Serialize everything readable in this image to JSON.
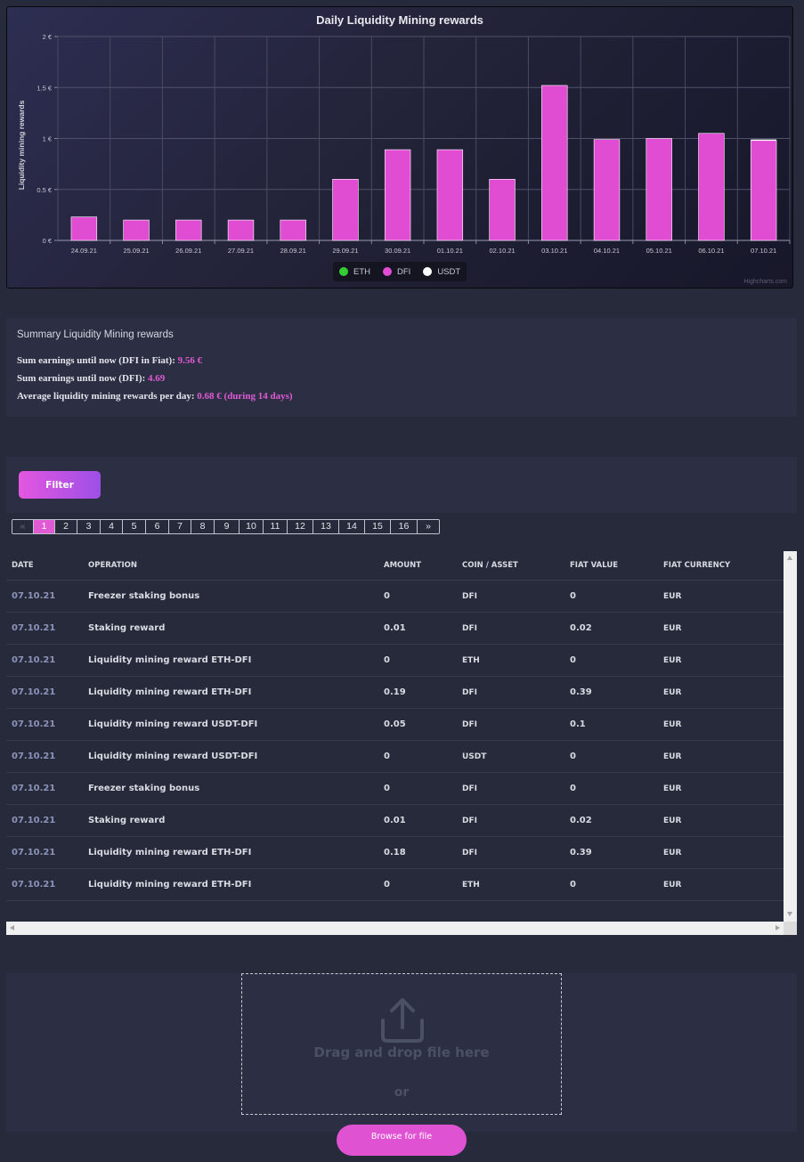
{
  "chart_data": {
    "type": "bar",
    "title": "Daily Liquidity Mining rewards",
    "ylabel": "Liquidity mining rewards",
    "categories": [
      "24.09.21",
      "25.09.21",
      "26.09.21",
      "27.09.21",
      "28.09.21",
      "29.09.21",
      "30.09.21",
      "01.10.21",
      "02.10.21",
      "03.10.21",
      "04.10.21",
      "05.10.21",
      "06.10.21",
      "07.10.21"
    ],
    "series": [
      {
        "name": "ETH",
        "color": "#33cc33",
        "values": [
          0,
          0,
          0,
          0,
          0,
          0,
          0,
          0,
          0,
          0,
          0,
          0,
          0,
          0
        ]
      },
      {
        "name": "DFI",
        "color": "#e04cd2",
        "values": [
          0.23,
          0.2,
          0.2,
          0.2,
          0.2,
          0.6,
          0.89,
          0.89,
          0.6,
          1.52,
          0.99,
          1.0,
          1.05,
          0.98
        ]
      },
      {
        "name": "USDT",
        "color": "#ffffff",
        "values": [
          0,
          0,
          0,
          0,
          0,
          0,
          0,
          0,
          0,
          0,
          0,
          0,
          0,
          0.01
        ]
      }
    ],
    "stacked": true,
    "ylim": [
      0,
      2
    ],
    "yticks": [
      "0 €",
      "0.5 €",
      "1 €",
      "1.5 €",
      "2 €"
    ],
    "grid": true,
    "legend_position": "bottom-center",
    "credits": "Highcharts.com"
  },
  "summary": {
    "title": "Summary Liquidity Mining rewards",
    "fiat_label": "Sum earnings until now (DFI in Fiat):",
    "fiat_value": "9.56 €",
    "dfi_label": "Sum earnings until now (DFI):",
    "dfi_value": "4.69",
    "avg_label": "Average liquidity mining rewards per day:",
    "avg_value": "0.68 € (during 14 days)"
  },
  "filter": {
    "label": "Filter"
  },
  "pagination": {
    "prev": "«",
    "next": "»",
    "pages": [
      "1",
      "2",
      "3",
      "4",
      "5",
      "6",
      "7",
      "8",
      "9",
      "10",
      "11",
      "12",
      "13",
      "14",
      "15",
      "16"
    ],
    "active": "1"
  },
  "table": {
    "columns": [
      "DATE",
      "OPERATION",
      "AMOUNT",
      "COIN / ASSET",
      "FIAT VALUE",
      "FIAT CURRENCY"
    ],
    "rows": [
      [
        "07.10.21",
        "Freezer staking bonus",
        "0",
        "DFI",
        "0",
        "EUR"
      ],
      [
        "07.10.21",
        "Staking reward",
        "0.01",
        "DFI",
        "0.02",
        "EUR"
      ],
      [
        "07.10.21",
        "Liquidity mining reward ETH-DFI",
        "0",
        "ETH",
        "0",
        "EUR"
      ],
      [
        "07.10.21",
        "Liquidity mining reward ETH-DFI",
        "0.19",
        "DFI",
        "0.39",
        "EUR"
      ],
      [
        "07.10.21",
        "Liquidity mining reward USDT-DFI",
        "0.05",
        "DFI",
        "0.1",
        "EUR"
      ],
      [
        "07.10.21",
        "Liquidity mining reward USDT-DFI",
        "0",
        "USDT",
        "0",
        "EUR"
      ],
      [
        "07.10.21",
        "Freezer staking bonus",
        "0",
        "DFI",
        "0",
        "EUR"
      ],
      [
        "07.10.21",
        "Staking reward",
        "0.01",
        "DFI",
        "0.02",
        "EUR"
      ],
      [
        "07.10.21",
        "Liquidity mining reward ETH-DFI",
        "0.18",
        "DFI",
        "0.39",
        "EUR"
      ],
      [
        "07.10.21",
        "Liquidity mining reward ETH-DFI",
        "0",
        "ETH",
        "0",
        "EUR"
      ]
    ]
  },
  "upload": {
    "drag_text": "Drag and drop file here",
    "or_text": "or",
    "browse_label": "Browse for file"
  }
}
